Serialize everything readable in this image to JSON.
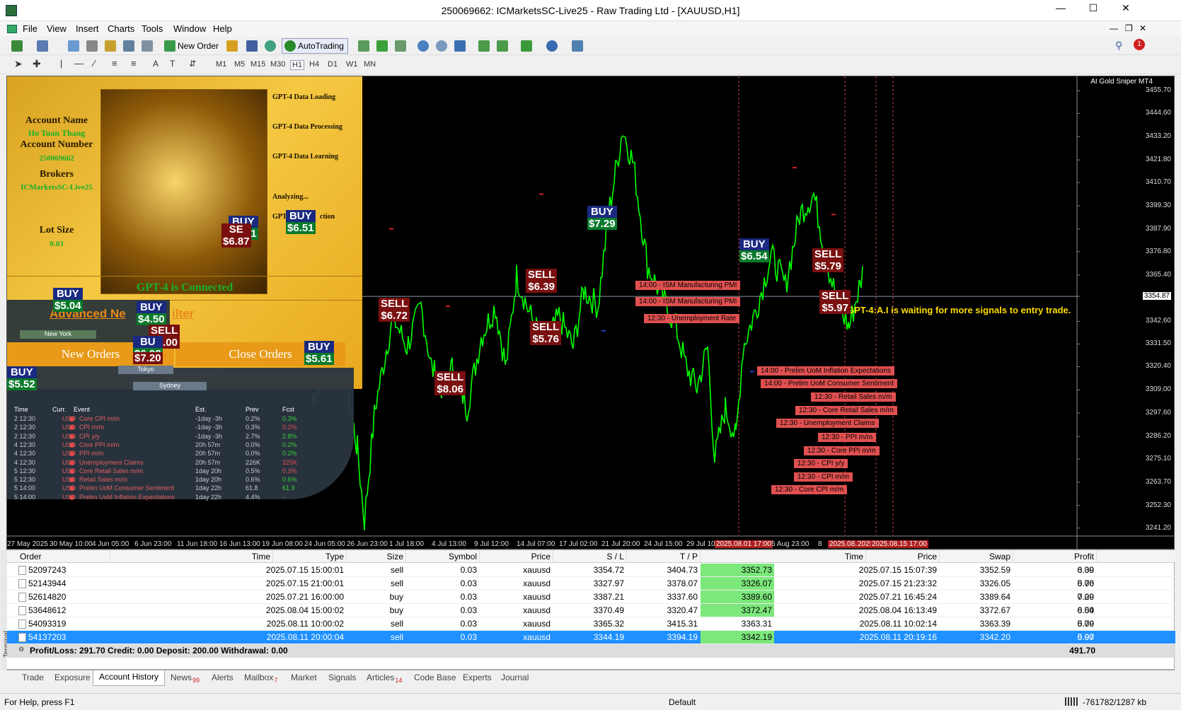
{
  "window": {
    "title": "250069662: ICMarketsSC-Live25 - Raw Trading Ltd - [XAUUSD,H1]",
    "minimize": "—",
    "maximize": "☐",
    "close": "✕"
  },
  "menu": [
    "File",
    "View",
    "Insert",
    "Charts",
    "Tools",
    "Window",
    "Help"
  ],
  "toolbar": {
    "new_order": "New Order",
    "auto_trading": "AutoTrading"
  },
  "timeframes": [
    "M1",
    "M5",
    "M15",
    "M30",
    "H1",
    "H4",
    "D1",
    "W1",
    "MN"
  ],
  "chart": {
    "indicator_name": "AI Gold Sniper MT4",
    "current_price": "3354.87",
    "y_axis": [
      "3455.70",
      "3444.60",
      "3433.20",
      "3421.80",
      "3410.70",
      "3399.30",
      "3387.90",
      "3376.80",
      "3365.40",
      "3354.87",
      "3342.60",
      "3331.50",
      "3320.40",
      "3309.00",
      "3297.60",
      "3286.20",
      "3275.10",
      "3263.70",
      "3252.30",
      "3241.20"
    ],
    "x_axis": [
      "27 May 2025",
      "30 May 10:00",
      "4 Jun 05:00",
      "6 Jun 23:00",
      "11 Jun 18:00",
      "16 Jun 13:00",
      "19 Jun 08:00",
      "24 Jun 05:00",
      "26 Jun 23:00",
      "1 Jul 18:00",
      "4 Jul 13:00",
      "9 Jul 12:00",
      "14 Jul 07:00",
      "17 Jul 02:00",
      "21 Jul 20:00",
      "24 Jul 15:00",
      "29 Jul 10",
      "2025.08.01 17:00",
      "5 Aug 23:00",
      "8",
      "2025.08.1:",
      "2025",
      "2025.08.15 17:00"
    ],
    "waiting_msg": "GPT-4:A.I is waiting for more signals to entry trade.",
    "signals": [
      {
        "type": "SELL",
        "value": "$6.72"
      },
      {
        "type": "SELL",
        "value": "$8.06"
      },
      {
        "type": "SELL",
        "value": "$6.39"
      },
      {
        "type": "SELL",
        "value": "$5.76"
      },
      {
        "type": "BUY",
        "value": "$7.29"
      },
      {
        "type": "BUY",
        "value": "$6.54"
      },
      {
        "type": "SELL",
        "value": "$5.79"
      },
      {
        "type": "SELL",
        "value": "$5.97"
      },
      {
        "type": "BUY",
        "value": "$6.51"
      },
      {
        "type": "BUY",
        "value": "$5.61"
      },
      {
        "type": "SE",
        "value": "$6.87"
      },
      {
        "type": "BUY",
        "value": "$5.04"
      },
      {
        "type": "BUY",
        "value": "$4.50"
      },
      {
        "type": "SELL",
        "value": "$6.00"
      },
      {
        "type": "BU",
        "value": "$6.03"
      },
      {
        "type": "BUY",
        "value": "$5.61"
      },
      {
        "type": "BUY",
        "value": "$5.52"
      },
      {
        "type": "",
        "value": "$7.20"
      }
    ],
    "news_markers": [
      "14:00 - ISM Manufacturing PMI",
      "14:00 - ISM Manufacturing PMI",
      "12:30 - Unemployment Rate",
      "14:00 - Prelim UoM Inflation Expectations",
      "14:00 - Prelim UoM Consumer Sentiment",
      "12:30 - Retail Sales m/m",
      "12:30 - Core Retail Sales m/m",
      "12:30 - Unemployment Claims",
      "12:30 - PPI m/m",
      "12:30 - Core PPI m/m",
      "12:30 - CPI y/y",
      "12:30 - CPI m/m",
      "12:30 - Core CPI m/m"
    ]
  },
  "panel": {
    "account_name_label": "Account Name",
    "account_name": "Ho Tuan Thang",
    "account_number_label": "Account Number",
    "account_number": "250069662",
    "brokers_label": "Brokers",
    "broker": "ICMarketsSC-Live25",
    "lot_label": "Lot Size",
    "lot": "0.03",
    "steps": [
      "GPT-4 Data Loading",
      "GPT-4 Data Processing",
      "GPT-4 Data Learning",
      "Analyzing...",
      "GPT-4 Si",
      "ction"
    ],
    "connected": "GPT-4 is Connected",
    "advanced": "Advanced Ne",
    "advanced2": "ilter",
    "new_orders": "New Orders",
    "close_orders": "Close Orders",
    "cities": [
      "New York",
      "Tokyo",
      "Sydney"
    ]
  },
  "events": {
    "headers": [
      "Time",
      "Curr.",
      "Event",
      "Est.",
      "Prev",
      "Fcst"
    ],
    "rows": [
      [
        "2 12:30",
        "USD",
        "Core CPI m/m",
        "-1day -3h",
        "0.2%",
        "0.3%"
      ],
      [
        "2 12:30",
        "USD",
        "CPI m/m",
        "-1day -3h",
        "0.3%",
        "0.2%"
      ],
      [
        "2 12:30",
        "USD",
        "CPI y/y",
        "-1day -3h",
        "2.7%",
        "2.8%"
      ],
      [
        "4 12:30",
        "USD",
        "Core PPI m/m",
        "20h 57m",
        "0.0%",
        "0.2%"
      ],
      [
        "4 12:30",
        "USD",
        "PPI m/m",
        "20h 57m",
        "0.0%",
        "0.2%"
      ],
      [
        "4 12:30",
        "USD",
        "Unemployment Claims",
        "20h 57m",
        "226K",
        "225K"
      ],
      [
        "5 12:30",
        "USD",
        "Core Retail Sales m/m",
        "1day 20h",
        "0.5%",
        "0.3%"
      ],
      [
        "5 12:30",
        "USD",
        "Retail Sales m/m",
        "1day 20h",
        "0.6%",
        "0.6%"
      ],
      [
        "5 14:00",
        "USD",
        "Prelim UoM Consumer Sentiment",
        "1day 22h",
        "61.8",
        "61.9"
      ],
      [
        "5 14:00",
        "USD",
        "Prelim UoM Inflation Expectations",
        "1day 22h",
        "4.4%",
        "-"
      ]
    ]
  },
  "terminal": {
    "side_label": "Terminal",
    "headers": [
      "Order",
      "Time",
      "Type",
      "Size",
      "Symbol",
      "Price",
      "S / L",
      "T / P",
      "Time",
      "Price",
      "Swap",
      "Profit"
    ],
    "rows": [
      [
        "52097243",
        "2025.07.15 15:00:01",
        "sell",
        "0.03",
        "xauusd",
        "3354.72",
        "3404.73",
        "3352.73",
        "2025.07.15 15:07:39",
        "3352.59",
        "0.00",
        "6.39"
      ],
      [
        "52143944",
        "2025.07.15 21:00:01",
        "sell",
        "0.03",
        "xauusd",
        "3327.97",
        "3378.07",
        "3326.07",
        "2025.07.15 21:23:32",
        "3326.05",
        "0.00",
        "5.76"
      ],
      [
        "52614820",
        "2025.07.21 16:00:00",
        "buy",
        "0.03",
        "xauusd",
        "3387.21",
        "3337.60",
        "3389.60",
        "2025.07.21 16:45:24",
        "3389.64",
        "0.00",
        "7.29"
      ],
      [
        "53648612",
        "2025.08.04 15:00:02",
        "buy",
        "0.03",
        "xauusd",
        "3370.49",
        "3320.47",
        "3372.47",
        "2025.08.04 16:13:49",
        "3372.67",
        "0.00",
        "6.54"
      ],
      [
        "54093319",
        "2025.08.11 10:00:02",
        "sell",
        "0.03",
        "xauusd",
        "3365.32",
        "3415.31",
        "3363.31",
        "2025.08.11 10:02:14",
        "3363.39",
        "0.00",
        "5.79"
      ],
      [
        "54137203",
        "2025.08.11 20:00:04",
        "sell",
        "0.03",
        "xauusd",
        "3344.19",
        "3394.19",
        "3342.19",
        "2025.08.11 20:19:16",
        "3342.20",
        "0.00",
        "5.97"
      ]
    ],
    "summary": "Profit/Loss: 291.70  Credit: 0.00  Deposit: 200.00  Withdrawal: 0.00",
    "total": "491.70"
  },
  "tabs": [
    {
      "label": "Trade"
    },
    {
      "label": "Exposure"
    },
    {
      "label": "Account History"
    },
    {
      "label": "News",
      "badge": "99"
    },
    {
      "label": "Alerts"
    },
    {
      "label": "Mailbox",
      "badge": "7"
    },
    {
      "label": "Market"
    },
    {
      "label": "Signals"
    },
    {
      "label": "Articles",
      "badge": "14"
    },
    {
      "label": "Code Base"
    },
    {
      "label": "Experts"
    },
    {
      "label": "Journal"
    }
  ],
  "status": {
    "help": "For Help, press F1",
    "profile": "Default",
    "traffic": "-761782/1287 kb"
  },
  "colors": {
    "candles": "#00ff00",
    "buy_bg": "#1a2a80",
    "sell_bg": "#7a1010",
    "news_bg": "#e05050",
    "selected_row": "#1e90ff"
  }
}
